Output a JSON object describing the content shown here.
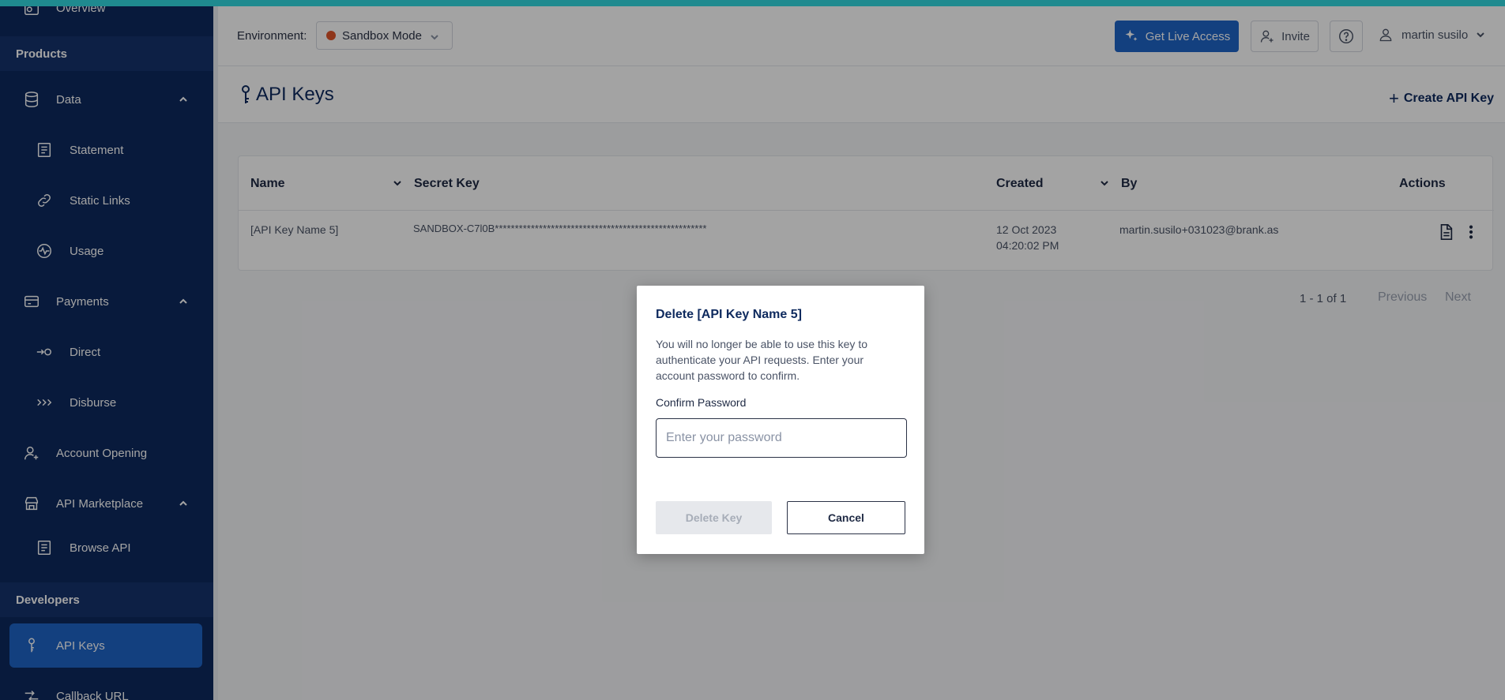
{
  "sidebar": {
    "overview_label": "Overview",
    "products_section": "Products",
    "data_label": "Data",
    "statement_label": "Statement",
    "static_links_label": "Static Links",
    "usage_label": "Usage",
    "payments_label": "Payments",
    "direct_label": "Direct",
    "disburse_label": "Disburse",
    "account_opening_label": "Account Opening",
    "api_marketplace_label": "API Marketplace",
    "browse_api_label": "Browse API",
    "developers_section": "Developers",
    "api_keys_label": "API Keys",
    "callback_url_label": "Callback URL"
  },
  "header": {
    "environment_label": "Environment:",
    "environment_value": "Sandbox Mode",
    "live_access_label": "Get Live Access",
    "invite_label": "Invite",
    "user_name": "martin susilo"
  },
  "page": {
    "title": "API Keys",
    "create_label": "Create API Key"
  },
  "table": {
    "columns": {
      "name": "Name",
      "secret_key": "Secret Key",
      "created": "Created",
      "by": "By",
      "actions": "Actions"
    },
    "rows": [
      {
        "name": "[API Key Name 5]",
        "secret_key": "SANDBOX-C7l0B*****************************************************",
        "created_date": "12 Oct 2023",
        "created_time": "04:20:02 PM",
        "by": "martin.susilo+031023@brank.as"
      }
    ],
    "pagination": {
      "range": "1 - 1 of 1",
      "previous": "Previous",
      "next": "Next"
    }
  },
  "modal": {
    "title": "Delete [API Key Name 5]",
    "description": "You will no longer be able to use this key to authenticate your API requests. Enter your account password to confirm.",
    "password_label": "Confirm Password",
    "password_placeholder": "Enter your password",
    "delete_label": "Delete Key",
    "cancel_label": "Cancel"
  },
  "colors": {
    "sidebar_bg": "#0e2a5e",
    "section_bg": "#15326d",
    "active_bg": "#1f64c7",
    "accent": "#1f8a8f",
    "env_dot": "#e0552b"
  }
}
